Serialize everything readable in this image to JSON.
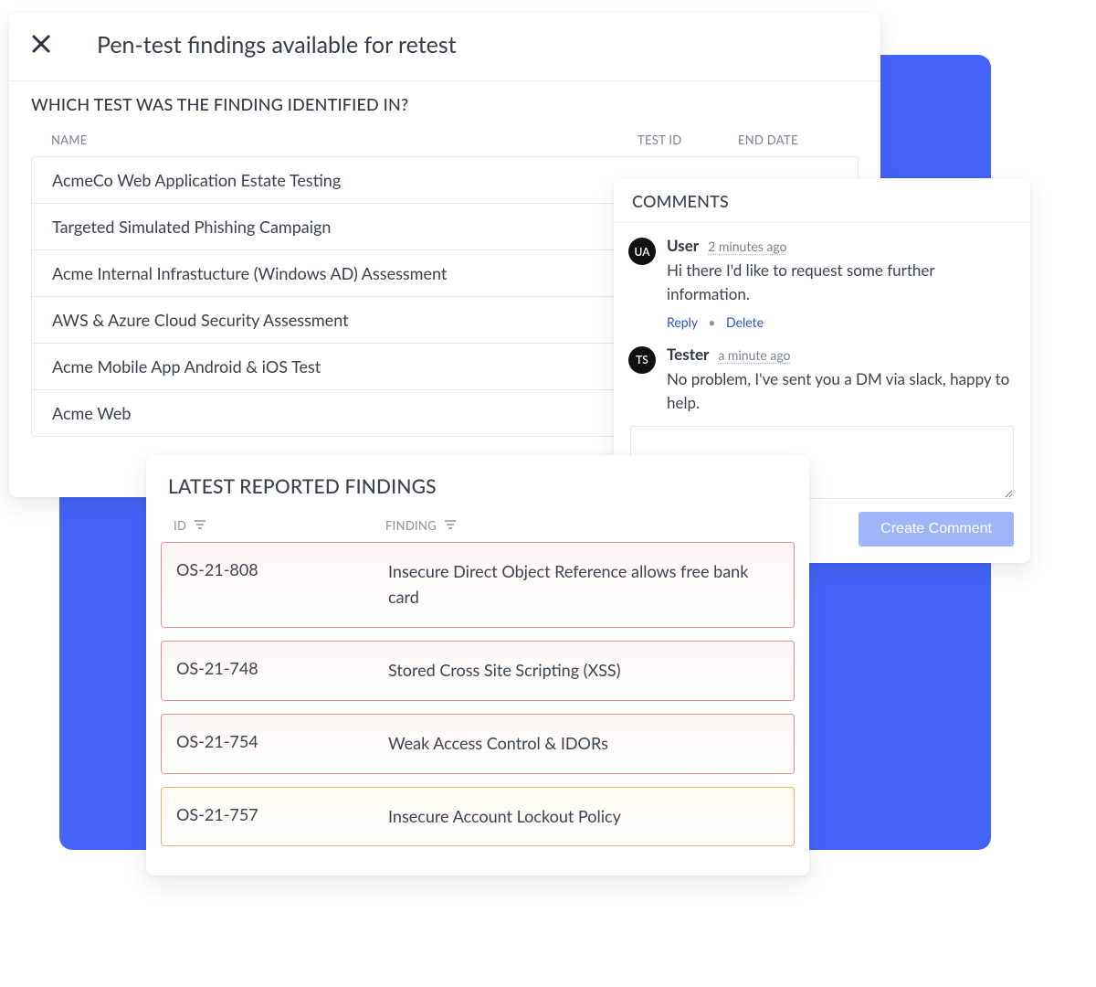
{
  "retest": {
    "title": "Pen-test findings available for retest",
    "question": "WHICH TEST WAS THE FINDING IDENTIFIED IN?",
    "columns": {
      "name": "NAME",
      "testid": "TEST ID",
      "enddate": "END DATE"
    },
    "tests": [
      {
        "name": "AcmeCo Web Application Estate Testing"
      },
      {
        "name": "Targeted Simulated Phishing Campaign"
      },
      {
        "name": "Acme Internal Infrastucture (Windows AD) Assessment"
      },
      {
        "name": "AWS & Azure Cloud Security Assessment"
      },
      {
        "name": "Acme Mobile App Android & iOS Test"
      },
      {
        "name": "Acme Web "
      }
    ]
  },
  "comments": {
    "title": "COMMENTS",
    "items": [
      {
        "avatar": "UA",
        "author": "User",
        "time": "2 minutes ago",
        "text": "Hi there I'd like to request some further information.",
        "actions": {
          "reply": "Reply",
          "delete": "Delete"
        }
      },
      {
        "avatar": "TS",
        "author": "Tester",
        "time": "a minute ago",
        "text": "No problem, I've sent you a DM via slack, happy to help."
      }
    ],
    "create_label": "Create Comment"
  },
  "findings": {
    "title": "LATEST REPORTED FINDINGS",
    "columns": {
      "id": "ID",
      "finding": "FINDING"
    },
    "items": [
      {
        "id": "OS-21-808",
        "finding": "Insecure Direct Object Reference allows free bank card",
        "severity": "red"
      },
      {
        "id": "OS-21-748",
        "finding": "Stored Cross Site Scripting (XSS)",
        "severity": "red"
      },
      {
        "id": "OS-21-754",
        "finding": "Weak Access Control & IDORs",
        "severity": "red"
      },
      {
        "id": "OS-21-757",
        "finding": "Insecure Account Lockout Policy",
        "severity": "orange"
      }
    ]
  }
}
